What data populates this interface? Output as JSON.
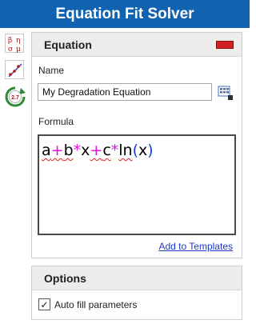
{
  "window": {
    "title": "Equation Fit Solver"
  },
  "toolstrip": {
    "tools": [
      {
        "icon": "greek-symbols-icon"
      },
      {
        "icon": "chart-fit-icon"
      },
      {
        "icon": "gauge-refresh-icon",
        "badge": "2.7"
      }
    ]
  },
  "equation_panel": {
    "header": "Equation",
    "name_label": "Name",
    "name_value": "My Degradation Equation",
    "formula_label": "Formula",
    "formula_tokens": [
      {
        "text": "a",
        "kind": "var",
        "squiggle": true
      },
      {
        "text": "+",
        "kind": "op",
        "squiggle": true
      },
      {
        "text": "b",
        "kind": "var",
        "squiggle": true
      },
      {
        "text": "*",
        "kind": "op",
        "squiggle": false
      },
      {
        "text": "x",
        "kind": "var",
        "squiggle": false
      },
      {
        "text": "+",
        "kind": "op",
        "squiggle": true
      },
      {
        "text": "c",
        "kind": "var",
        "squiggle": true
      },
      {
        "text": "*",
        "kind": "op",
        "squiggle": false
      },
      {
        "text": "ln",
        "kind": "fn",
        "squiggle": true
      },
      {
        "text": "(",
        "kind": "paren",
        "squiggle": false
      },
      {
        "text": "x",
        "kind": "var",
        "squiggle": false
      },
      {
        "text": ")",
        "kind": "paren",
        "squiggle": false
      }
    ],
    "add_link": "Add to Templates"
  },
  "options_panel": {
    "header": "Options",
    "auto_fill_label": "Auto fill parameters",
    "auto_fill_checked": true,
    "check_mark": "✓"
  },
  "colors": {
    "title_bar": "#1163b1",
    "operator": "#e012d6",
    "paren": "#1640d8",
    "link": "#1a39c8",
    "marker": "#d21f1f"
  }
}
